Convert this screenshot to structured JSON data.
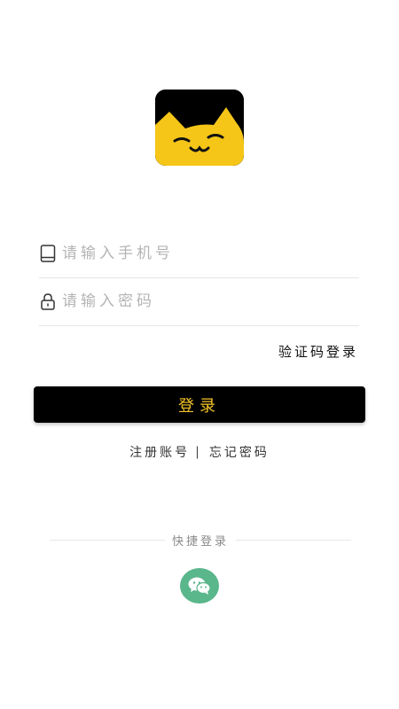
{
  "app": {
    "logo_icon": "cat-face-icon",
    "brand_colors": {
      "logo_bg": "#000000",
      "logo_cat": "#f5c518",
      "button_bg": "#000000",
      "button_text": "#f3c32a",
      "wechat": "#5ab68b"
    }
  },
  "form": {
    "phone": {
      "icon": "phone-icon",
      "placeholder": "请输入手机号",
      "value": ""
    },
    "password": {
      "icon": "lock-icon",
      "placeholder": "请输入密码",
      "value": ""
    },
    "code_login_label": "验证码登录",
    "login_label": "登录"
  },
  "links": {
    "register_label": "注册账号",
    "separator": "|",
    "forgot_label": "忘记密码"
  },
  "quick_login": {
    "label": "快捷登录",
    "wechat_icon": "wechat-icon"
  }
}
